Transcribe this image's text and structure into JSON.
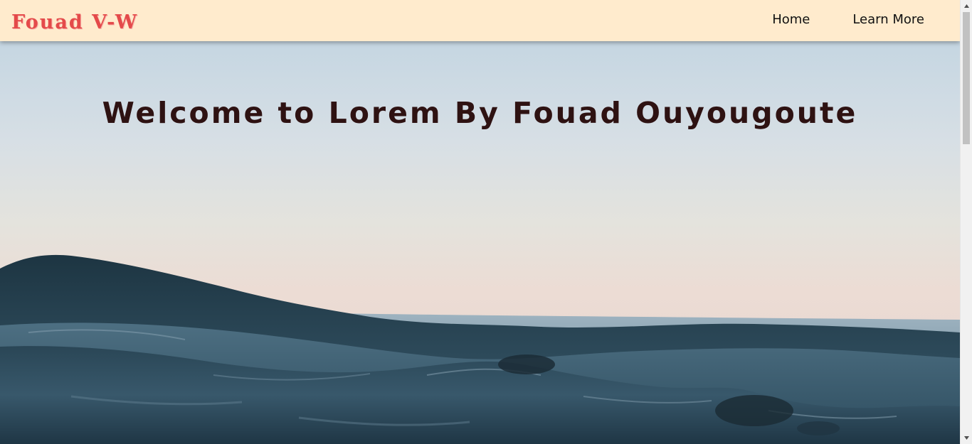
{
  "navbar": {
    "brand": "Fouad V-W",
    "links": [
      "Home",
      "Learn More"
    ]
  },
  "hero": {
    "title": "Welcome to Lorem By Fouad Ouyougoute"
  },
  "colors": {
    "navbar_bg": "#ffebcd",
    "brand": "#e44a4a",
    "title": "#2e1212",
    "sea_dark": "#1e3a4a",
    "sky_top": "#c6d5e1"
  },
  "icons": {
    "scroll_up": "triangle-up",
    "scroll_down": "triangle-down"
  }
}
